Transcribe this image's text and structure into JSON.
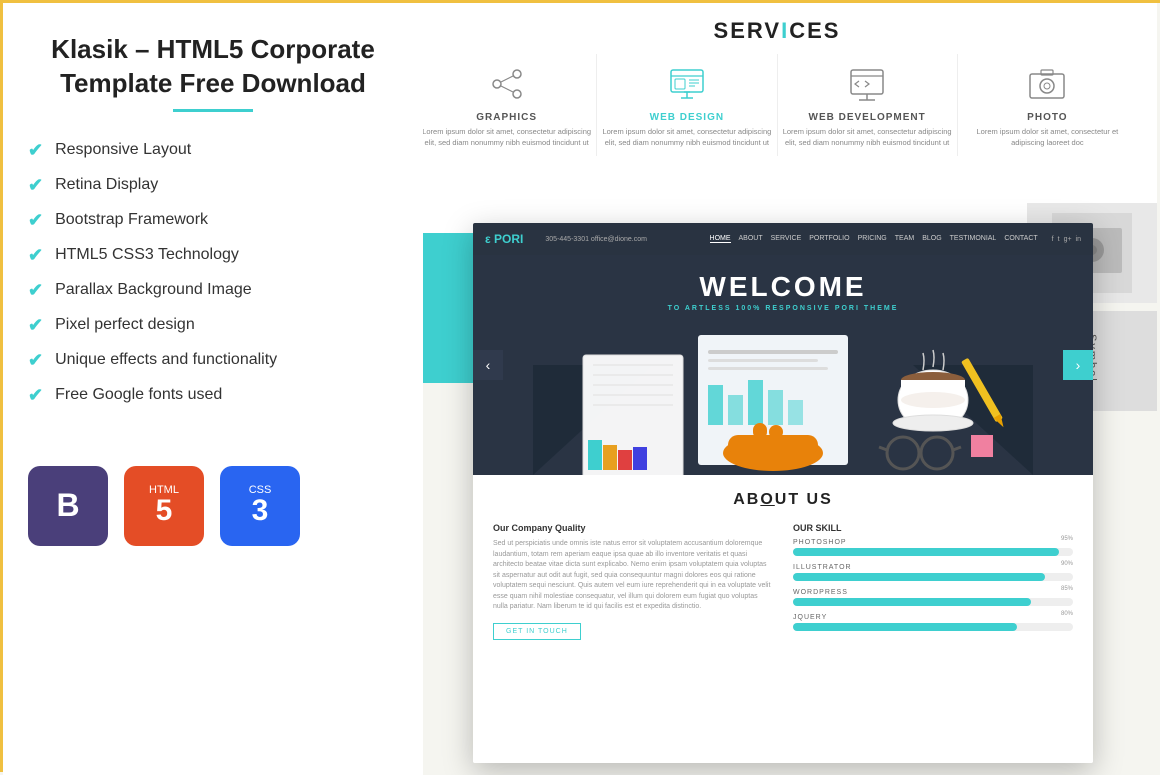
{
  "page": {
    "border_color": "#f0c040"
  },
  "left_panel": {
    "title": "Klasik – HTML5 Corporate Template Free Download",
    "underline_color": "#3ecfcf",
    "features": [
      "Responsive Layout",
      "Retina Display",
      "Bootstrap Framework",
      "HTML5 CSS3 Technology",
      "Parallax Background Image",
      "Pixel perfect design",
      "Unique effects and functionality",
      "Free Google fonts used"
    ],
    "badges": [
      {
        "id": "bootstrap",
        "label": "B",
        "bg": "#4a3f7a"
      },
      {
        "id": "html5",
        "label": "HTML 5",
        "bg": "#e44d26"
      },
      {
        "id": "css3",
        "label": "CSS 3",
        "bg": "#2965f1"
      }
    ]
  },
  "services_section": {
    "title_part1": "SERV",
    "title_accent": "I",
    "title_part2": "CES",
    "items": [
      {
        "label": "GRAPHICS",
        "active": false,
        "desc": "Lorem ipsum dolor sit amet, consectetur adipiscing elit, sed diam nonummy nibh euismod tincidunt ut"
      },
      {
        "label": "WEB DESIGN",
        "active": true,
        "desc": "Lorem ipsum dolor sit amet, consectetur adipiscing elit, sed diam nonummy nibh euismod tincidunt ut"
      },
      {
        "label": "WEB DEVELOPMENT",
        "active": false,
        "desc": "Lorem ipsum dolor sit amet, consectetur adipiscing elit, sed diam nonummy nibh euismod tincidunt ut"
      },
      {
        "label": "PHOTO",
        "active": false,
        "desc": "Lorem ipsum dolor sit amet, consectetur et adipiscing laoreet doc"
      }
    ]
  },
  "preview": {
    "nav": {
      "logo_prefix": "e",
      "logo_name": "PORI",
      "contact": "305-445-3301  office@dione.com",
      "links": [
        "HOME",
        "ABOUT",
        "SERVICE",
        "PORTFOLIO",
        "PRICING",
        "TEAM",
        "BLOG",
        "TESTIMONIAL",
        "CONTACT"
      ]
    },
    "hero": {
      "title": "WELCOME",
      "subtitle": "TO ARTLESS 100% RESPONSIVE",
      "subtitle_brand": "PORI",
      "subtitle_end": "THEME"
    },
    "about": {
      "title_pre": "AB",
      "title_underline": "O",
      "title_post": "UT US",
      "left_title": "Our Company Quality",
      "left_text": "Sed ut perspiciatis unde omnis iste natus error sit voluptatem accusantium doloremque laudantium, totam rem aperiam eaque ipsa quae ab illo inventore veritatis et quasi architecto beatae vitae dicta sunt explicabo. Nemo enim ipsam voluptatem quia voluptas sit aspernatur aut odit aut fugit, sed quia consequuntur magni dolores eos qui ratione voluptatem sequi nesciunt. Quis autem vel eum iure reprehenderit qui in ea voluptate velit esse quam nihil molestiae consequatur, vel illum qui dolorem eum fugiat quo voluptas nulla pariatur. Nam liberum te id qui facilis est et expedita distinctio.",
      "btn_label": "GET IN TOUCH",
      "right_title": "OUR SKILL",
      "skills": [
        {
          "name": "PHOTOSHOP",
          "pct": 95
        },
        {
          "name": "ILLUSTRATOR",
          "pct": 90
        },
        {
          "name": "WORDPRESS",
          "pct": 85
        },
        {
          "name": "JQUERY",
          "pct": 80
        }
      ]
    }
  },
  "side_card": {
    "label": "Symbol."
  }
}
